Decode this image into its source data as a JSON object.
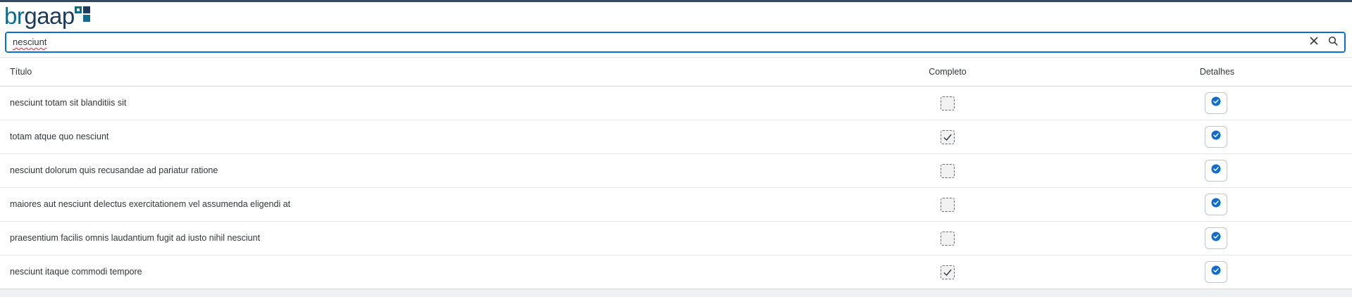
{
  "header": {
    "logo_br": "br",
    "logo_gaap": "gaap",
    "colors": {
      "top_bar": "#354a5f",
      "logo_primary": "#0e6b8c",
      "logo_secondary": "#1d3b5c"
    }
  },
  "search": {
    "value": "nesciunt",
    "placeholder": "",
    "clear_icon": "close-icon",
    "search_icon": "search-icon"
  },
  "table": {
    "columns": {
      "title": "Título",
      "complete": "Completo",
      "details": "Detalhes"
    },
    "rows": [
      {
        "title": "nesciunt totam sit blanditiis sit",
        "complete": false
      },
      {
        "title": "totam atque quo nesciunt",
        "complete": true
      },
      {
        "title": "nesciunt dolorum quis recusandae ad pariatur ratione",
        "complete": false
      },
      {
        "title": "maiores aut nesciunt delectus exercitationem vel assumenda eligendi at",
        "complete": false
      },
      {
        "title": "praesentium facilis omnis laudantium fugit ad iusto nihil nesciunt",
        "complete": false
      },
      {
        "title": "nesciunt itaque commodi tempore",
        "complete": true
      }
    ],
    "detail_icon": "check-circle-icon",
    "accent": "#0a6ed1"
  }
}
